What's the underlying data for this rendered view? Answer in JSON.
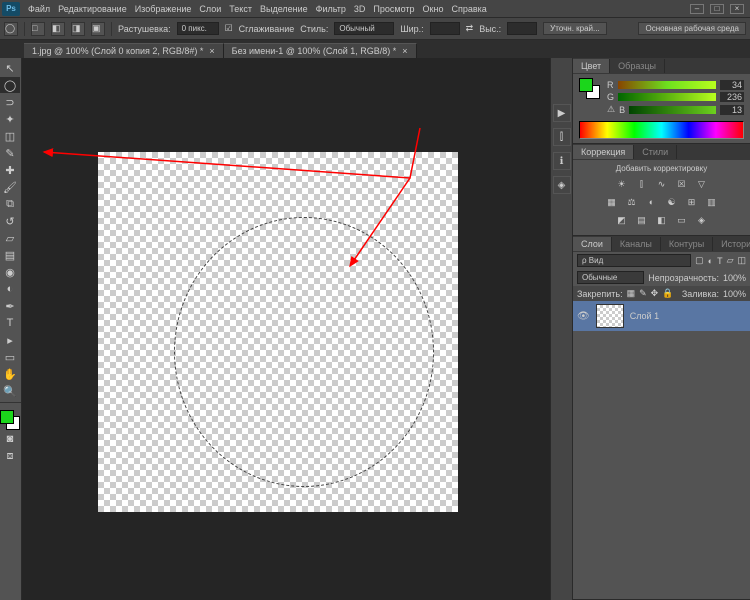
{
  "menu": {
    "file": "Файл",
    "edit": "Редактирование",
    "image": "Изображение",
    "layers": "Слои",
    "text": "Текст",
    "select": "Выделение",
    "filter": "Фильтр",
    "threeD": "3D",
    "view": "Просмотр",
    "window": "Окно",
    "help": "Справка"
  },
  "workspace_btn": "Основная рабочая среда",
  "options": {
    "feather_label": "Растушевка:",
    "feather_value": "0 пикс.",
    "antialias": "Сглаживание",
    "styles": "Стиль:",
    "style_value": "Обычный",
    "width": "Шир.:",
    "height": "Выс.:",
    "refine": "Уточн. край..."
  },
  "tabs": [
    {
      "title": "1.jpg @ 100% (Слой 0 копия 2, RGB/8#) *"
    },
    {
      "title": "Без имени-1 @ 100% (Слой 1, RGB/8) *"
    }
  ],
  "panel_color": {
    "tab_color": "Цвет",
    "tab_samples": "Образцы",
    "r": "R",
    "g": "G",
    "b": "B",
    "r_val": "34",
    "g_val": "236",
    "b_val": "13",
    "warn": "⚠"
  },
  "panel_adj": {
    "tab_corr": "Коррекция",
    "tab_styles": "Стили",
    "add_label": "Добавить корректировку"
  },
  "panel_layers": {
    "tabs": {
      "layers": "Слои",
      "channels": "Каналы",
      "paths": "Контуры",
      "history": "История"
    },
    "filter": "ρ Вид",
    "mode": "Обычные",
    "opacity_label": "Непрозрачность:",
    "opacity": "100%",
    "lock_label": "Закрепить:",
    "fill_label": "Заливка:",
    "fill": "100%",
    "layer_name": "Слой 1"
  }
}
